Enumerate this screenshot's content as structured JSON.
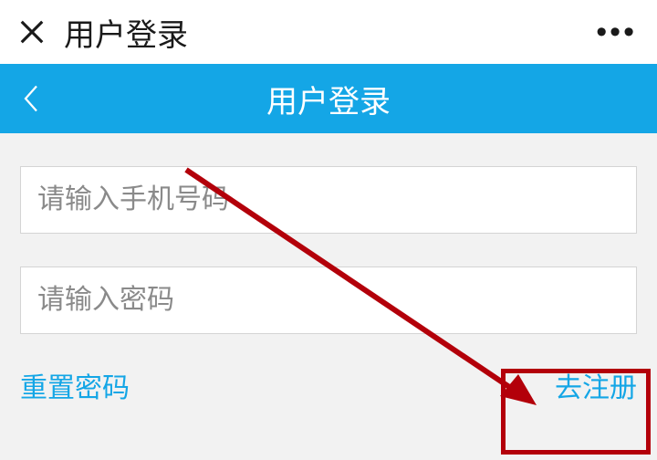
{
  "system": {
    "title": "用户登录"
  },
  "header": {
    "title": "用户登录"
  },
  "form": {
    "phone_placeholder": "请输入手机号码",
    "password_placeholder": "请输入密码"
  },
  "links": {
    "reset": "重置密码",
    "register": "去注册"
  },
  "colors": {
    "accent": "#14a6e6",
    "annotation": "#b3000a"
  }
}
